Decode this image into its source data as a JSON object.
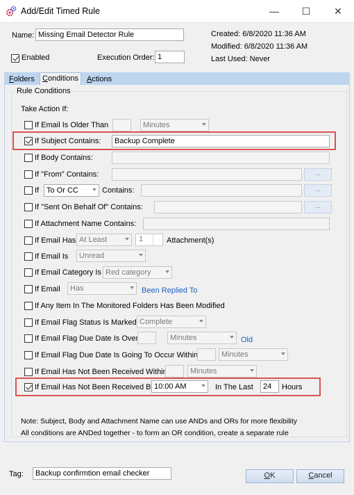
{
  "window": {
    "title": "Add/Edit Timed Rule",
    "minimize": "—",
    "maximize": "☐",
    "close": "✕"
  },
  "header": {
    "name_label": "Name:",
    "name_value": "Missing Email Detector Rule",
    "enabled_label": "Enabled",
    "enabled_checked": true,
    "exec_order_label": "Execution Order:",
    "exec_order_value": "1",
    "created": "Created: 6/8/2020 11:36 AM",
    "modified": "Modified: 6/8/2020 11:36 AM",
    "last_used": "Last Used: Never"
  },
  "tabs": [
    {
      "label": "Folders",
      "accel": "F",
      "rest": "olders"
    },
    {
      "label": "Conditions",
      "accel": "C",
      "rest": "onditions"
    },
    {
      "label": "Actions",
      "accel": "A",
      "rest": "ctions"
    }
  ],
  "conditions": {
    "group_title": "Rule Conditions",
    "take_action": "Take Action If:",
    "older_than": {
      "label": "If Email Is Older Than",
      "value": "",
      "unit": "Minutes",
      "checked": false
    },
    "subject": {
      "label": "If Subject Contains:",
      "value": "Backup Complete",
      "checked": true
    },
    "body": {
      "label": "If Body Contains:",
      "value": "",
      "checked": false
    },
    "from": {
      "label": "If \"From\" Contains:",
      "value": "",
      "button": "...",
      "checked": false
    },
    "to": {
      "label": "If",
      "select": "To Or CC",
      "label2": "Contains:",
      "value": "",
      "button": "...",
      "checked": false
    },
    "behalf": {
      "label": "If \"Sent On Behalf Of\" Contains:",
      "value": "",
      "button": "...",
      "checked": false
    },
    "attachment_name": {
      "label": "If Attachment Name Contains:",
      "value": "",
      "checked": false
    },
    "has_attach": {
      "label": "If Email Has",
      "select": "At Least",
      "count": "1",
      "suffix": "Attachment(s)",
      "checked": false
    },
    "is": {
      "label": "If Email Is",
      "select": "Unread",
      "checked": false
    },
    "category": {
      "label": "If Email Category Is",
      "select": "Red category",
      "checked": false
    },
    "replied": {
      "label": "If Email",
      "select": "Has",
      "suffix": "Been Replied To",
      "checked": false
    },
    "modified": {
      "label": "If Any Item In The Monitored Folders Has Been Modified",
      "checked": false
    },
    "flag_status": {
      "label": "If Email Flag Status Is Marked",
      "select": "Complete",
      "checked": false
    },
    "flag_over": {
      "label": "If Email Flag Due Date Is Over",
      "value": "",
      "unit": "Minutes",
      "suffix": "Old",
      "checked": false
    },
    "flag_within": {
      "label": "If Email Flag Due Date Is Going To Occur Within",
      "value": "",
      "unit": "Minutes",
      "checked": false
    },
    "not_received_within": {
      "label": "If Email Has Not Been Received Within",
      "value": "",
      "unit": "Minutes",
      "checked": false
    },
    "not_received_by": {
      "label": "If Email Has Not Been Received By",
      "time": "10:00 AM",
      "in_last": "In The Last",
      "hours_value": "24",
      "hours_label": "Hours",
      "checked": true
    },
    "note1": "Note: Subject, Body and Attachment Name can use ANDs and ORs for more flexibility",
    "note2": "All conditions are ANDed together - to form an OR condition, create a separate rule"
  },
  "footer": {
    "tag_label": "Tag:",
    "tag_value": "Backup confirmtion email checker",
    "ok": {
      "accel": "O",
      "rest": "K"
    },
    "cancel": {
      "accel": "C",
      "rest": "ancel"
    }
  },
  "colors": {
    "highlight": "#d9534f",
    "tab_strip": "#bdd5ef",
    "link_blue": "#1f5fbf"
  }
}
